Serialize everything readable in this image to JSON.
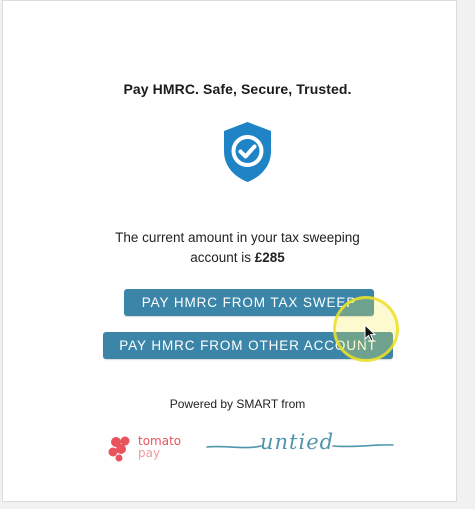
{
  "page": {
    "headline": "Pay HMRC. Safe, Secure, Trusted.",
    "shield_icon": "shield-check-icon",
    "accent_color": "#1e84c6",
    "button_color": "#3b86a8"
  },
  "balance": {
    "line1": "The current amount in your tax sweeping",
    "line2_prefix": "account is ",
    "amount": "£285"
  },
  "actions": {
    "pay_from_tax_sweep": "PAY HMRC FROM TAX SWEEP",
    "pay_from_other_account": "PAY HMRC FROM OTHER ACCOUNT"
  },
  "footer": {
    "powered_by": "Powered by SMART from",
    "tomato_brand": "tomato",
    "tomato_sub": "pay",
    "untied_brand": "untied",
    "tomato_color": "#e8535c",
    "untied_color": "#4f96ad"
  }
}
